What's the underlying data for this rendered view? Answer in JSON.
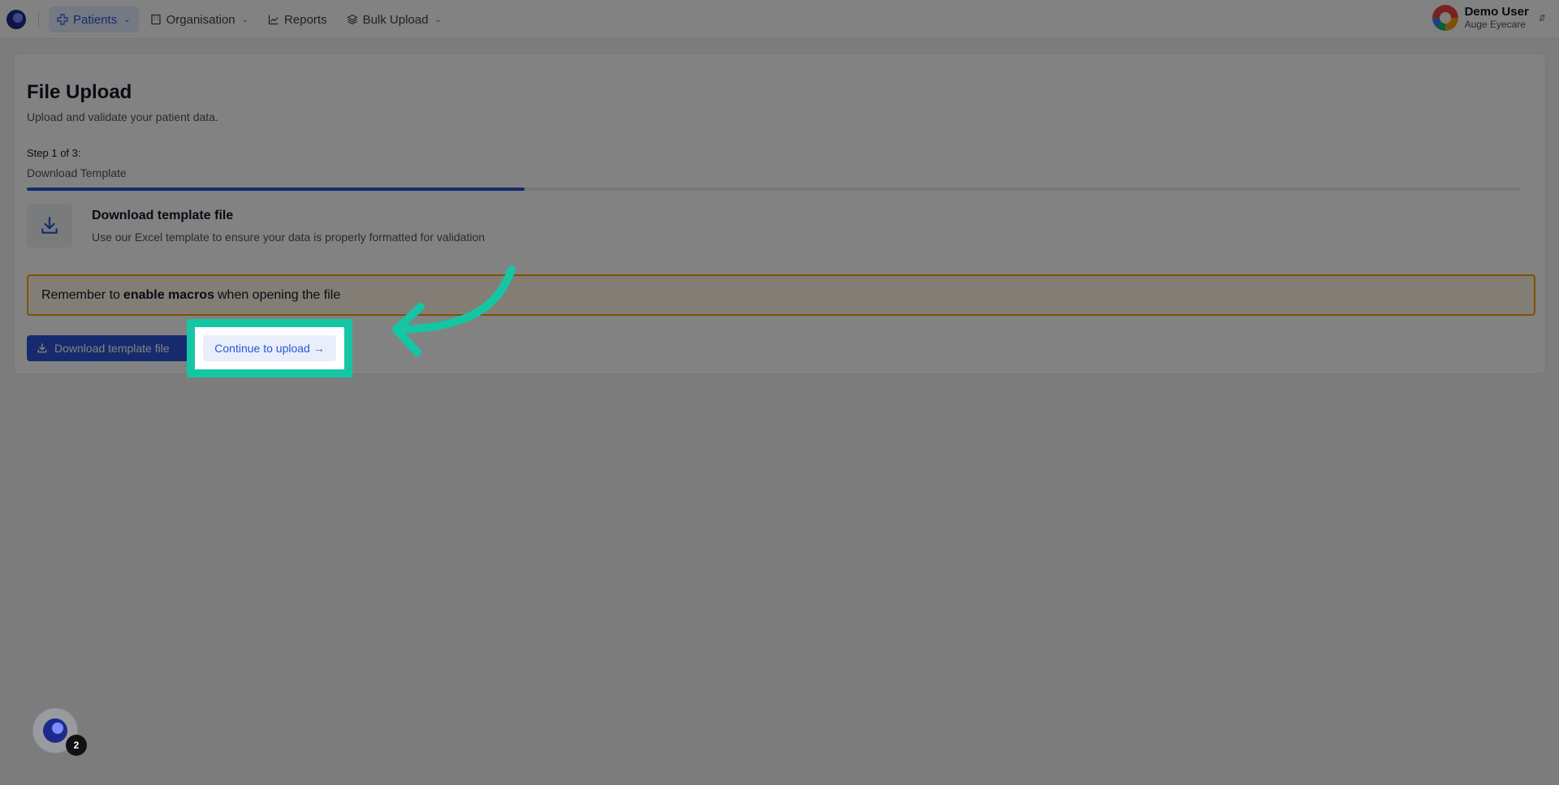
{
  "nav": {
    "items": [
      {
        "label": "Patients",
        "icon": "medical-cross-icon",
        "has_dropdown": true,
        "active": true
      },
      {
        "label": "Organisation",
        "icon": "building-icon",
        "has_dropdown": true,
        "active": false
      },
      {
        "label": "Reports",
        "icon": "line-chart-icon",
        "has_dropdown": false,
        "active": false
      },
      {
        "label": "Bulk Upload",
        "icon": "layers-icon",
        "has_dropdown": true,
        "active": false
      }
    ]
  },
  "user": {
    "name": "Demo User",
    "organisation": "Auge Eyecare"
  },
  "page": {
    "title": "File Upload",
    "subtitle": "Upload and validate your patient data."
  },
  "stepper": {
    "step_label": "Step 1 of 3:",
    "step_name": "Download Template",
    "progress_fraction": 0.333
  },
  "download_section": {
    "title": "Download template file",
    "description": "Use our Excel template to ensure your data is properly formatted for validation"
  },
  "alert": {
    "prefix": "Remember to",
    "bold": "enable macros",
    "suffix": "when opening the file"
  },
  "buttons": {
    "download_label": "Download template file",
    "continue_label": "Continue to upload →"
  },
  "widget": {
    "badge_count": "2"
  },
  "colors": {
    "primary": "#2b55d6",
    "highlight": "#14c6a4",
    "alert_border": "#f5a300"
  }
}
